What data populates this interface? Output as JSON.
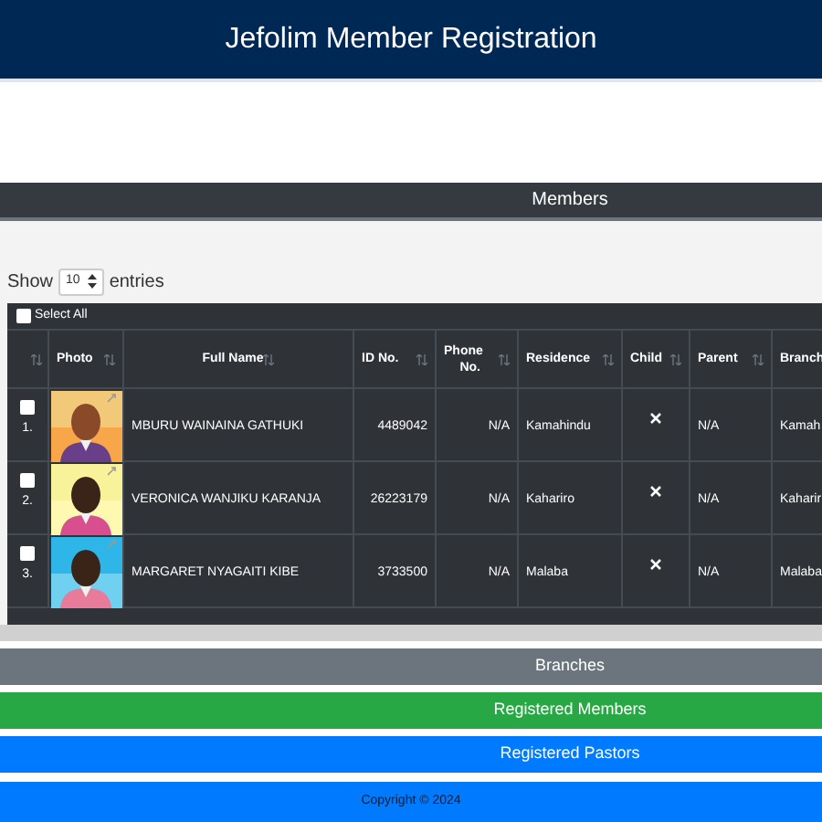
{
  "header": {
    "title": "Jefolim Member Registration"
  },
  "section_bar": {
    "label": "Members"
  },
  "length_control": {
    "prefix": "Show",
    "value": "10",
    "suffix": "entries"
  },
  "table": {
    "select_all": {
      "label": "Select All",
      "checked": false
    },
    "columns": [
      "Photo",
      "Full Name",
      "ID No.",
      "Phone No.",
      "Residence",
      "Child",
      "Parent",
      "Branch"
    ],
    "rows": [
      {
        "number": "1.",
        "checked": false,
        "full_name": "MBURU WAINAINA GATHUKI",
        "id_no": "4489042",
        "phone_no": "N/A",
        "residence": "Kamahindu",
        "child": false,
        "parent": "N/A",
        "branch": "Kamah"
      },
      {
        "number": "2.",
        "checked": false,
        "full_name": "VERONICA WANJIKU KARANJA",
        "id_no": "26223179",
        "phone_no": "N/A",
        "residence": "Kahariro",
        "child": false,
        "parent": "N/A",
        "branch": "Kaharir"
      },
      {
        "number": "3.",
        "checked": false,
        "full_name": "MARGARET NYAGAITI KIBE",
        "id_no": "3733500",
        "phone_no": "N/A",
        "residence": "Malaba",
        "child": false,
        "parent": "N/A",
        "branch": "Malaba"
      }
    ]
  },
  "nav_buttons": [
    {
      "label": "Branches",
      "color": "#6c757d"
    },
    {
      "label": "Registered Members",
      "color": "#28a745"
    },
    {
      "label": "Registered Pastors",
      "color": "#007bff"
    }
  ],
  "footer": {
    "text": "Copyright © 2024"
  }
}
